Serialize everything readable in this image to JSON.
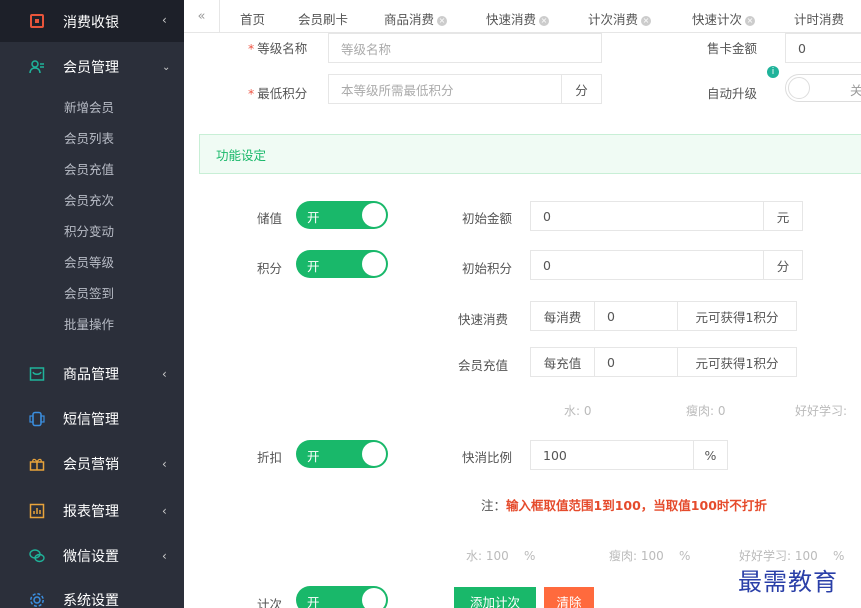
{
  "sidebar": {
    "top": {
      "label": "消费收银"
    },
    "member": {
      "label": "会员管理"
    },
    "sub_items": [
      "新增会员",
      "会员列表",
      "会员充值",
      "会员充次",
      "积分变动",
      "会员等级",
      "会员签到",
      "批量操作"
    ],
    "items": [
      {
        "label": "商品管理"
      },
      {
        "label": "短信管理"
      },
      {
        "label": "会员营销"
      },
      {
        "label": "报表管理"
      },
      {
        "label": "微信设置"
      },
      {
        "label": "系统设置"
      }
    ]
  },
  "tabs": {
    "items": [
      "首页",
      "会员刷卡",
      "商品消费",
      "快速消费",
      "计次消费",
      "快速计次",
      "计时消费"
    ]
  },
  "form": {
    "level_name": {
      "label": "等级名称",
      "placeholder": "等级名称"
    },
    "card_amount": {
      "label": "售卡金额",
      "value": "0"
    },
    "min_points": {
      "label": "最低积分",
      "placeholder": "本等级所需最低积分",
      "unit": "分"
    },
    "auto_upgrade": {
      "label": "自动升级",
      "state": "关"
    }
  },
  "section": {
    "title": "功能设定"
  },
  "stored_value": {
    "label": "储值",
    "state": "开",
    "field_label": "初始金额",
    "value": "0",
    "unit": "元"
  },
  "points": {
    "label": "积分",
    "state": "开",
    "field_label": "初始积分",
    "value": "0",
    "unit": "分"
  },
  "quick_consume": {
    "label": "快速消费",
    "prefix": "每消费",
    "value": "0",
    "suffix": "元可获得1积分"
  },
  "member_recharge": {
    "label": "会员充值",
    "prefix": "每充值",
    "value": "0",
    "suffix": "元可获得1积分"
  },
  "faded_points": [
    {
      "label": "水:",
      "value": "0"
    },
    {
      "label": "瘦肉:",
      "value": "0"
    },
    {
      "label": "好好学习:",
      "value": ""
    }
  ],
  "discount": {
    "label": "折扣",
    "state": "开",
    "field_label": "快消比例",
    "value": "100",
    "unit": "%"
  },
  "note": {
    "prefix": "注：",
    "text": "输入框取值范围1到100，当取值100时不打折"
  },
  "faded_discount": [
    {
      "label": "水:",
      "value": "100",
      "unit": "%"
    },
    {
      "label": "瘦肉:",
      "value": "100",
      "unit": "%"
    },
    {
      "label": "好好学习:",
      "value": "100",
      "unit": "%"
    }
  ],
  "count": {
    "label": "计次",
    "state": "开",
    "add_button": "添加计次",
    "clear_button": "清除"
  },
  "watermark": "最需教育",
  "colors": {
    "sidebar": "#2b2f3a",
    "accent_green": "#19b86a",
    "danger": "#e54b2c",
    "orange": "#ff6a3d",
    "icon_teal": "#1fb39a"
  }
}
